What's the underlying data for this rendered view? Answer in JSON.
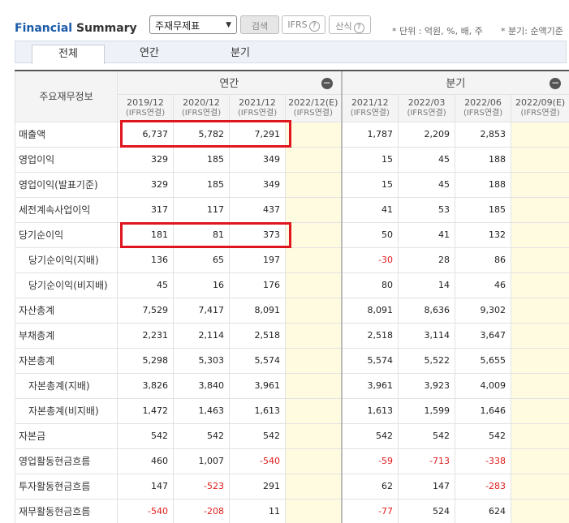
{
  "header": {
    "title_part1": "Financial",
    "title_part2": " Summary",
    "select_value": "주재무제표",
    "search_label": "검색",
    "ifrs_label": "IFRS",
    "formula_label": "산식",
    "unit_text": "* 단위 : 억원, %, 배, 주",
    "period_text": "* 분기: 순액기준"
  },
  "tabs": [
    "전체",
    "연간",
    "분기"
  ],
  "table": {
    "label_header": "주요재무정보",
    "annual_header": "연간",
    "quarter_header": "분기",
    "ifrs_note": "(IFRS연결)",
    "annual_periods": [
      "2019/12",
      "2020/12",
      "2021/12",
      "2022/12(E)"
    ],
    "quarter_periods": [
      "2021/12",
      "2022/03",
      "2022/06",
      "2022/09(E)"
    ],
    "rows": [
      {
        "label": "매출액",
        "sub": false,
        "annual": [
          "6,737",
          "5,782",
          "7,291",
          ""
        ],
        "quarter": [
          "1,787",
          "2,209",
          "2,853",
          ""
        ]
      },
      {
        "label": "영업이익",
        "sub": false,
        "annual": [
          "329",
          "185",
          "349",
          ""
        ],
        "quarter": [
          "15",
          "45",
          "188",
          ""
        ]
      },
      {
        "label": "영업이익(발표기준)",
        "sub": false,
        "annual": [
          "329",
          "185",
          "349",
          ""
        ],
        "quarter": [
          "15",
          "45",
          "188",
          ""
        ]
      },
      {
        "label": "세전계속사업이익",
        "sub": false,
        "annual": [
          "317",
          "117",
          "437",
          ""
        ],
        "quarter": [
          "41",
          "53",
          "185",
          ""
        ]
      },
      {
        "label": "당기순이익",
        "sub": false,
        "annual": [
          "181",
          "81",
          "373",
          ""
        ],
        "quarter": [
          "50",
          "41",
          "132",
          ""
        ]
      },
      {
        "label": "당기순이익(지배)",
        "sub": true,
        "annual": [
          "136",
          "65",
          "197",
          ""
        ],
        "quarter": [
          "-30",
          "28",
          "86",
          ""
        ]
      },
      {
        "label": "당기순이익(비지배)",
        "sub": true,
        "annual": [
          "45",
          "16",
          "176",
          ""
        ],
        "quarter": [
          "80",
          "14",
          "46",
          ""
        ]
      },
      {
        "label": "자산총계",
        "sub": false,
        "annual": [
          "7,529",
          "7,417",
          "8,091",
          ""
        ],
        "quarter": [
          "8,091",
          "8,636",
          "9,302",
          ""
        ]
      },
      {
        "label": "부채총계",
        "sub": false,
        "annual": [
          "2,231",
          "2,114",
          "2,518",
          ""
        ],
        "quarter": [
          "2,518",
          "3,114",
          "3,647",
          ""
        ]
      },
      {
        "label": "자본총계",
        "sub": false,
        "annual": [
          "5,298",
          "5,303",
          "5,574",
          ""
        ],
        "quarter": [
          "5,574",
          "5,522",
          "5,655",
          ""
        ]
      },
      {
        "label": "자본총계(지배)",
        "sub": true,
        "annual": [
          "3,826",
          "3,840",
          "3,961",
          ""
        ],
        "quarter": [
          "3,961",
          "3,923",
          "4,009",
          ""
        ]
      },
      {
        "label": "자본총계(비지배)",
        "sub": true,
        "annual": [
          "1,472",
          "1,463",
          "1,613",
          ""
        ],
        "quarter": [
          "1,613",
          "1,599",
          "1,646",
          ""
        ]
      },
      {
        "label": "자본금",
        "sub": false,
        "annual": [
          "542",
          "542",
          "542",
          ""
        ],
        "quarter": [
          "542",
          "542",
          "542",
          ""
        ]
      },
      {
        "label": "영업활동현금흐름",
        "sub": false,
        "annual": [
          "460",
          "1,007",
          "-540",
          ""
        ],
        "quarter": [
          "-59",
          "-713",
          "-338",
          ""
        ]
      },
      {
        "label": "투자활동현금흐름",
        "sub": false,
        "annual": [
          "147",
          "-523",
          "291",
          ""
        ],
        "quarter": [
          "62",
          "147",
          "-283",
          ""
        ]
      },
      {
        "label": "재무활동현금흐름",
        "sub": false,
        "annual": [
          "-540",
          "-208",
          "11",
          ""
        ],
        "quarter": [
          "-77",
          "524",
          "624",
          ""
        ]
      }
    ]
  },
  "colors": {
    "highlight": "#e0161f",
    "estimate_bg": "#fffbe0",
    "negative": "#e01b1b",
    "brand_blue": "#1a5aa8"
  }
}
